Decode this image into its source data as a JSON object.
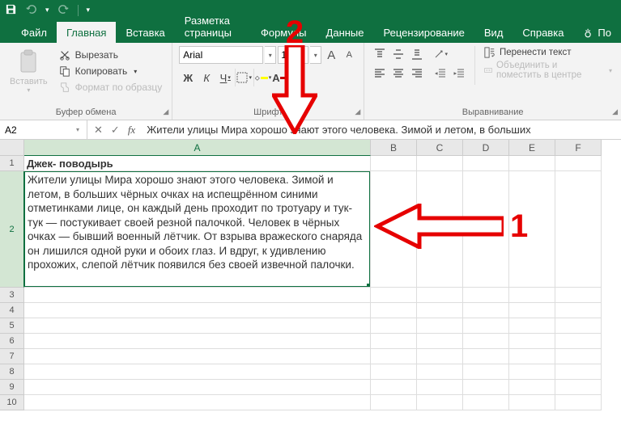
{
  "qat": {
    "save_tip": "Сохранить",
    "undo_tip": "Отменить",
    "redo_tip": "Вернуть"
  },
  "tabs": {
    "file": "Файл",
    "home": "Главная",
    "insert": "Вставка",
    "page_layout": "Разметка страницы",
    "formulas": "Формулы",
    "data": "Данные",
    "review": "Рецензирование",
    "view": "Вид",
    "help": "Справка",
    "tellme": "По"
  },
  "ribbon": {
    "clipboard": {
      "paste": "Вставить",
      "cut": "Вырезать",
      "copy": "Копировать",
      "format_painter": "Формат по образцу",
      "group": "Буфер обмена"
    },
    "font": {
      "name": "Arial",
      "size": "10,5",
      "bold": "Ж",
      "italic": "К",
      "underline": "Ч",
      "group": "Шрифт",
      "grow": "A",
      "shrink": "A"
    },
    "alignment": {
      "wrap": "Перенести текст",
      "merge": "Объединить и поместить в центре",
      "group": "Выравнивание"
    }
  },
  "namebox": {
    "ref": "A2"
  },
  "formula_bar": {
    "text": "Жители улицы Мира хорошо знают этого человека. Зимой и летом, в больших"
  },
  "columns": [
    "A",
    "B",
    "C",
    "D",
    "E",
    "F"
  ],
  "cells": {
    "A1": "Джек- поводырь",
    "A2": "Жители улицы Мира хорошо знают этого человека. Зимой и летом, в больших чёрных очках на испещрённом синими отметинками лице, он каждый день проходит по тротуару и тук-тук — постукивает своей резной палочкой. Человек в чёрных очках — бывший военный лётчик. От взрыва вражеского снаряда он лишился одной руки и обоих глаз. И вдруг, к удивлению прохожих, слепой лётчик появился без своей извечной палочки."
  },
  "annotations": {
    "one": "1",
    "two": "2"
  }
}
